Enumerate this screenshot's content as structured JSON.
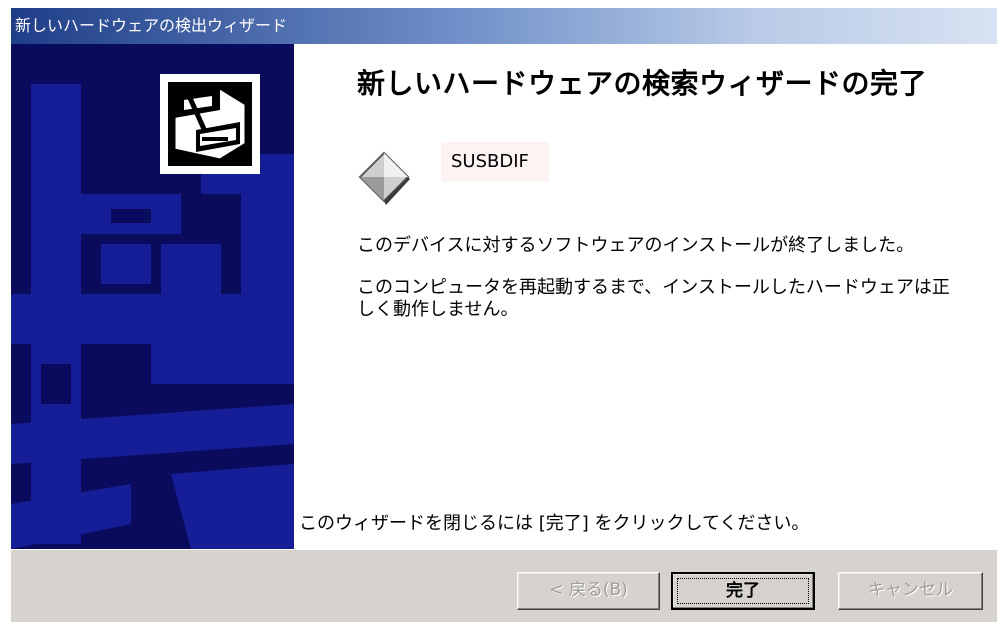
{
  "window": {
    "title": "新しいハードウェアの検出ウィザード"
  },
  "sidebar": {
    "icon": "hardware-box-icon",
    "colors": {
      "background": "#0b0b5e",
      "pattern": "#16209a",
      "icon_frame": "#ffffff"
    }
  },
  "main": {
    "heading": "新しいハードウェアの検索ウィザードの完了",
    "device": {
      "icon": "device-diamond-icon",
      "name": "SUSBDIF"
    },
    "message_1": "このデバイスに対するソフトウェアのインストールが終了しました。",
    "message_2": "このコンピュータを再起動するまで、インストールしたハードウェアは正しく動作しません。",
    "closing": "このウィザードを閉じるには [完了] をクリックしてください。"
  },
  "buttons": {
    "back": "< 戻る(B)",
    "finish": "完了",
    "cancel": "キャンセル"
  }
}
